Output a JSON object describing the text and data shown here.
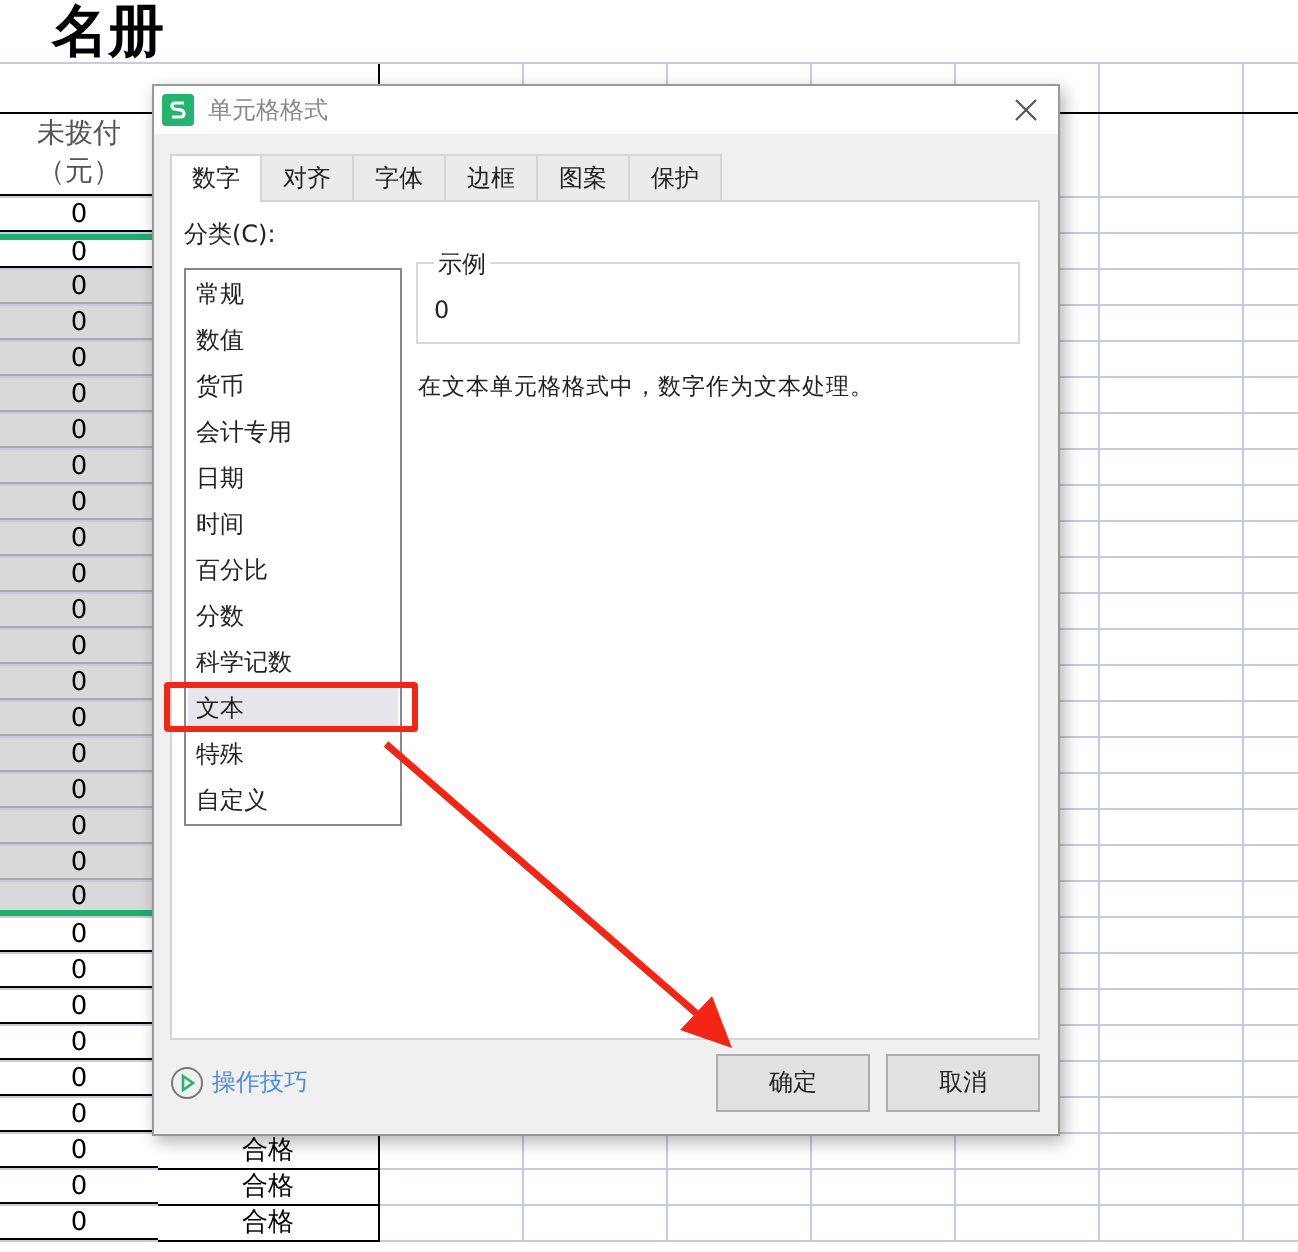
{
  "sheet": {
    "title": "名册",
    "column_a_header": "未拨付（元）",
    "rows": [
      {
        "a": "0",
        "selected": false,
        "active": false
      },
      {
        "a": "0",
        "selected": false,
        "active": true
      },
      {
        "a": "0",
        "selected": true,
        "active": false
      },
      {
        "a": "0",
        "selected": true,
        "active": false
      },
      {
        "a": "0",
        "selected": true,
        "active": false
      },
      {
        "a": "0",
        "selected": true,
        "active": false
      },
      {
        "a": "0",
        "selected": true,
        "active": false
      },
      {
        "a": "0",
        "selected": true,
        "active": false
      },
      {
        "a": "0",
        "selected": true,
        "active": false
      },
      {
        "a": "0",
        "selected": true,
        "active": false
      },
      {
        "a": "0",
        "selected": true,
        "active": false
      },
      {
        "a": "0",
        "selected": true,
        "active": false
      },
      {
        "a": "0",
        "selected": true,
        "active": false
      },
      {
        "a": "0",
        "selected": true,
        "active": false
      },
      {
        "a": "0",
        "selected": true,
        "active": false
      },
      {
        "a": "0",
        "selected": true,
        "active": false
      },
      {
        "a": "0",
        "selected": true,
        "active": false
      },
      {
        "a": "0",
        "selected": true,
        "active": false
      },
      {
        "a": "0",
        "selected": true,
        "active": false
      },
      {
        "a": "0",
        "selected": true,
        "active": false
      },
      {
        "a": "0",
        "selected": false,
        "active": false
      },
      {
        "a": "0",
        "selected": false,
        "active": false
      },
      {
        "a": "0",
        "selected": false,
        "active": false
      },
      {
        "a": "0",
        "selected": false,
        "active": false
      },
      {
        "a": "0",
        "selected": false,
        "active": false
      },
      {
        "a": "0",
        "selected": false,
        "active": false
      },
      {
        "a": "0",
        "b": "合格",
        "selected": false,
        "active": false
      },
      {
        "a": "0",
        "b": "合格",
        "selected": false,
        "active": false
      },
      {
        "a": "0",
        "b": "合格",
        "selected": false,
        "active": false
      }
    ]
  },
  "dialog": {
    "title": "单元格格式",
    "tabs": [
      {
        "label": "数字",
        "selected": true
      },
      {
        "label": "对齐",
        "selected": false
      },
      {
        "label": "字体",
        "selected": false
      },
      {
        "label": "边框",
        "selected": false
      },
      {
        "label": "图案",
        "selected": false
      },
      {
        "label": "保护",
        "selected": false
      }
    ],
    "category_label": "分类(C):",
    "categories": [
      {
        "label": "常规",
        "selected": false
      },
      {
        "label": "数值",
        "selected": false
      },
      {
        "label": "货币",
        "selected": false
      },
      {
        "label": "会计专用",
        "selected": false
      },
      {
        "label": "日期",
        "selected": false
      },
      {
        "label": "时间",
        "selected": false
      },
      {
        "label": "百分比",
        "selected": false
      },
      {
        "label": "分数",
        "selected": false
      },
      {
        "label": "科学记数",
        "selected": false
      },
      {
        "label": "文本",
        "selected": true
      },
      {
        "label": "特殊",
        "selected": false
      },
      {
        "label": "自定义",
        "selected": false
      }
    ],
    "sample": {
      "legend": "示例",
      "value": "0"
    },
    "description": "在文本单元格格式中，数字作为文本处理。",
    "tips_link": "操作技巧",
    "buttons": [
      "确定",
      "取消"
    ]
  }
}
